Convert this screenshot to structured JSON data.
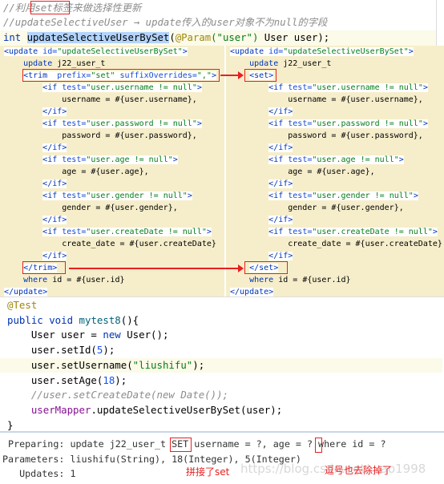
{
  "interface_header": {
    "comment1": "//利用set标签来做选择性更新",
    "comment2": "//updateSelectiveUser → update传入的user对象不为null的字段",
    "signature": {
      "kw": "int ",
      "method": "updateSelectiveUserBySet",
      "open": "(",
      "annotation": "@Param",
      "arg": "(\"user\")",
      "rest": " User user);"
    }
  },
  "xml_left": [
    [
      [
        "tag",
        "<update "
      ],
      [
        "attr",
        "id="
      ],
      [
        "str",
        "\"updateSelectiveUserBySet\""
      ],
      [
        "tag",
        ">"
      ]
    ],
    [
      [
        "txt",
        "    "
      ],
      [
        "kwx",
        "update"
      ],
      [
        "txt",
        " j22_user_t"
      ]
    ],
    [
      [
        "txt",
        "    "
      ],
      [
        "tag",
        "<trim  "
      ],
      [
        "attr",
        "prefix="
      ],
      [
        "str",
        "\"set\""
      ],
      [
        "attr",
        " suffixOverrides="
      ],
      [
        "str",
        "\",\""
      ],
      [
        "tag",
        ">"
      ]
    ],
    [
      [
        "txt",
        "        "
      ],
      [
        "tag",
        "<if "
      ],
      [
        "attr",
        "test="
      ],
      [
        "str",
        "\"user.username != null\""
      ],
      [
        "tag",
        ">"
      ]
    ],
    [
      [
        "txt",
        "            username = #{user.username},"
      ]
    ],
    [
      [
        "txt",
        "        "
      ],
      [
        "tag",
        "</if>"
      ]
    ],
    [
      [
        "txt",
        "        "
      ],
      [
        "tag",
        "<if "
      ],
      [
        "attr",
        "test="
      ],
      [
        "str",
        "\"user.password != null\""
      ],
      [
        "tag",
        ">"
      ]
    ],
    [
      [
        "txt",
        "            password = #{user.password},"
      ]
    ],
    [
      [
        "txt",
        "        "
      ],
      [
        "tag",
        "</if>"
      ]
    ],
    [
      [
        "txt",
        "        "
      ],
      [
        "tag",
        "<if "
      ],
      [
        "attr",
        "test="
      ],
      [
        "str",
        "\"user.age != null\""
      ],
      [
        "tag",
        ">"
      ]
    ],
    [
      [
        "txt",
        "            age = #{user.age},"
      ]
    ],
    [
      [
        "txt",
        "        "
      ],
      [
        "tag",
        "</if>"
      ]
    ],
    [
      [
        "txt",
        "        "
      ],
      [
        "tag",
        "<if "
      ],
      [
        "attr",
        "test="
      ],
      [
        "str",
        "\"user.gender != null\""
      ],
      [
        "tag",
        ">"
      ]
    ],
    [
      [
        "txt",
        "            gender = #{user.gender},"
      ]
    ],
    [
      [
        "txt",
        "        "
      ],
      [
        "tag",
        "</if>"
      ]
    ],
    [
      [
        "txt",
        "        "
      ],
      [
        "tag",
        "<if "
      ],
      [
        "attr",
        "test="
      ],
      [
        "str",
        "\"user.createDate != null\""
      ],
      [
        "tag",
        ">"
      ]
    ],
    [
      [
        "txt",
        "            create_date = #{user.createDate}"
      ]
    ],
    [
      [
        "txt",
        "        "
      ],
      [
        "tag",
        "</if>"
      ]
    ],
    [
      [
        "txt",
        "    "
      ],
      [
        "tag",
        "</trim>"
      ]
    ],
    [
      [
        "txt",
        "    "
      ],
      [
        "kwx",
        "where"
      ],
      [
        "txt",
        " id = #{user.id}"
      ]
    ],
    [
      [
        "tag",
        "</update>"
      ]
    ]
  ],
  "xml_right": [
    [
      [
        "tag",
        "<update "
      ],
      [
        "attr",
        "id="
      ],
      [
        "str",
        "\"updateSelectiveUserBySet\""
      ],
      [
        "tag",
        ">"
      ]
    ],
    [
      [
        "txt",
        "    "
      ],
      [
        "kwx",
        "update"
      ],
      [
        "txt",
        " j22_user_t"
      ]
    ],
    [
      [
        "txt",
        "    "
      ],
      [
        "tag",
        "<set>"
      ]
    ],
    [
      [
        "txt",
        "        "
      ],
      [
        "tag",
        "<if "
      ],
      [
        "attr",
        "test="
      ],
      [
        "str",
        "\"user.username != null\""
      ],
      [
        "tag",
        ">"
      ]
    ],
    [
      [
        "txt",
        "            username = #{user.username},"
      ]
    ],
    [
      [
        "txt",
        "        "
      ],
      [
        "tag",
        "</if>"
      ]
    ],
    [
      [
        "txt",
        "        "
      ],
      [
        "tag",
        "<if "
      ],
      [
        "attr",
        "test="
      ],
      [
        "str",
        "\"user.password != null\""
      ],
      [
        "tag",
        ">"
      ]
    ],
    [
      [
        "txt",
        "            password = #{user.password},"
      ]
    ],
    [
      [
        "txt",
        "        "
      ],
      [
        "tag",
        "</if>"
      ]
    ],
    [
      [
        "txt",
        "        "
      ],
      [
        "tag",
        "<if "
      ],
      [
        "attr",
        "test="
      ],
      [
        "str",
        "\"user.age != null\""
      ],
      [
        "tag",
        ">"
      ]
    ],
    [
      [
        "txt",
        "            age = #{user.age},"
      ]
    ],
    [
      [
        "txt",
        "        "
      ],
      [
        "tag",
        "</if>"
      ]
    ],
    [
      [
        "txt",
        "        "
      ],
      [
        "tag",
        "<if "
      ],
      [
        "attr",
        "test="
      ],
      [
        "str",
        "\"user.gender != null\""
      ],
      [
        "tag",
        ">"
      ]
    ],
    [
      [
        "txt",
        "            gender = #{user.gender},"
      ]
    ],
    [
      [
        "txt",
        "        "
      ],
      [
        "tag",
        "</if>"
      ]
    ],
    [
      [
        "txt",
        "        "
      ],
      [
        "tag",
        "<if "
      ],
      [
        "attr",
        "test="
      ],
      [
        "str",
        "\"user.createDate != null\""
      ],
      [
        "tag",
        ">"
      ]
    ],
    [
      [
        "txt",
        "            create_date = #{user.createDate}"
      ]
    ],
    [
      [
        "txt",
        "        "
      ],
      [
        "tag",
        "</if>"
      ]
    ],
    [
      [
        "txt",
        "    "
      ],
      [
        "tag",
        "</set>"
      ]
    ],
    [
      [
        "txt",
        "    "
      ],
      [
        "kwx",
        "where"
      ],
      [
        "txt",
        " id = #{user.id}"
      ]
    ],
    [
      [
        "tag",
        "</update>"
      ]
    ]
  ],
  "java": [
    [
      [
        "ann",
        "@Test"
      ]
    ],
    [
      [
        "kw",
        "public void "
      ],
      [
        "fn",
        "mytest8"
      ],
      [
        "txt",
        "(){"
      ]
    ],
    [
      [
        "txt",
        "    User user = "
      ],
      [
        "kw",
        "new"
      ],
      [
        "txt",
        " User();"
      ]
    ],
    [
      [
        "txt",
        "    user.setId("
      ],
      [
        "num",
        "5"
      ],
      [
        "txt",
        ");"
      ]
    ],
    [
      [
        "txt",
        "    user.setUsername("
      ],
      [
        "jstr",
        "\"liushifu\""
      ],
      [
        "txt",
        ");"
      ]
    ],
    [
      [
        "txt",
        "    user.setAge("
      ],
      [
        "num",
        "18"
      ],
      [
        "txt",
        ");"
      ]
    ],
    [
      [
        "cm",
        "    //user.setCreateDate(new Date());"
      ]
    ],
    [
      [
        "txt",
        "    "
      ],
      [
        "fld",
        "userMapper"
      ],
      [
        "txt",
        ".updateSelectiveUserBySet(user);"
      ]
    ],
    [
      [
        "txt",
        "}"
      ]
    ]
  ],
  "log": {
    "preparing": " Preparing: update j22_user_t SET username = ?, age = ? where id = ?",
    "parameters": "Parameters: liushifu(String), 18(Integer), 5(Integer)",
    "updates": "   Updates: 1"
  },
  "annotations": {
    "set_joined": "拼接了set",
    "comma_removed": "逗号也去除掉了"
  },
  "watermark": "https://blog.csdn.net/...ao1998",
  "colors": {
    "highlight_box": "#e82020",
    "xml_panel_bg": "#f6eecb"
  }
}
